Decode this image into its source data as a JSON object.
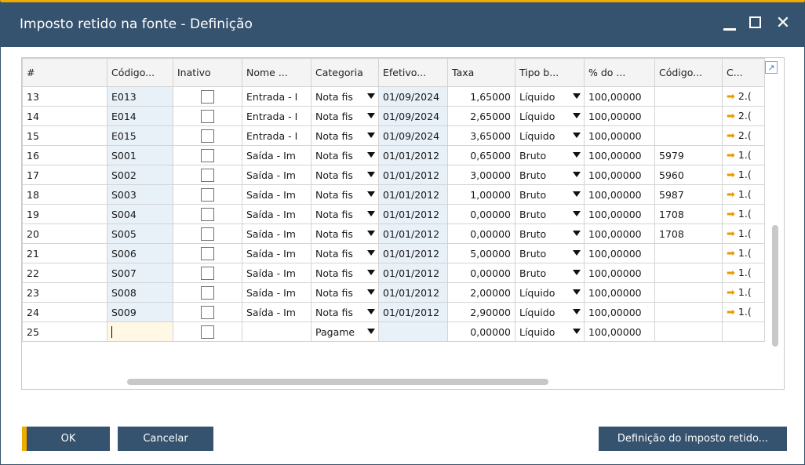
{
  "window": {
    "title": "Imposto retido na fonte - Definição",
    "accent_color": "#f0ab00",
    "titlebar_color": "#35526e"
  },
  "grid": {
    "columns": [
      "#",
      "Código...",
      "Inativo",
      "Nome ...",
      "Categoria",
      "Efetivo...",
      "Taxa",
      "Tipo b...",
      "% do ...",
      "Código...",
      "C..."
    ],
    "rows": [
      {
        "n": "13",
        "code": "E013",
        "name": "Entrada - I",
        "cat": "Nota fis",
        "eff": "01/09/2024",
        "rate": "1,65000",
        "base": "Líquido",
        "pct": "100,00000",
        "code2": "",
        "c": "2.("
      },
      {
        "n": "14",
        "code": "E014",
        "name": "Entrada - I",
        "cat": "Nota fis",
        "eff": "01/09/2024",
        "rate": "2,65000",
        "base": "Líquido",
        "pct": "100,00000",
        "code2": "",
        "c": "2.("
      },
      {
        "n": "15",
        "code": "E015",
        "name": "Entrada - I",
        "cat": "Nota fis",
        "eff": "01/09/2024",
        "rate": "3,65000",
        "base": "Líquido",
        "pct": "100,00000",
        "code2": "",
        "c": "2.("
      },
      {
        "n": "16",
        "code": "S001",
        "name": "Saída - Im",
        "cat": "Nota fis",
        "eff": "01/01/2012",
        "rate": "0,65000",
        "base": "Bruto",
        "pct": "100,00000",
        "code2": "5979",
        "c": "1.("
      },
      {
        "n": "17",
        "code": "S002",
        "name": "Saída - Im",
        "cat": "Nota fis",
        "eff": "01/01/2012",
        "rate": "3,00000",
        "base": "Bruto",
        "pct": "100,00000",
        "code2": "5960",
        "c": "1.("
      },
      {
        "n": "18",
        "code": "S003",
        "name": "Saída - Im",
        "cat": "Nota fis",
        "eff": "01/01/2012",
        "rate": "1,00000",
        "base": "Bruto",
        "pct": "100,00000",
        "code2": "5987",
        "c": "1.("
      },
      {
        "n": "19",
        "code": "S004",
        "name": "Saída - Im",
        "cat": "Nota fis",
        "eff": "01/01/2012",
        "rate": "0,00000",
        "base": "Bruto",
        "pct": "100,00000",
        "code2": "1708",
        "c": "1.("
      },
      {
        "n": "20",
        "code": "S005",
        "name": "Saída - Im",
        "cat": "Nota fis",
        "eff": "01/01/2012",
        "rate": "0,00000",
        "base": "Bruto",
        "pct": "100,00000",
        "code2": "1708",
        "c": "1.("
      },
      {
        "n": "21",
        "code": "S006",
        "name": "Saída - Im",
        "cat": "Nota fis",
        "eff": "01/01/2012",
        "rate": "5,00000",
        "base": "Bruto",
        "pct": "100,00000",
        "code2": "",
        "c": "1.("
      },
      {
        "n": "22",
        "code": "S007",
        "name": "Saída - Im",
        "cat": "Nota fis",
        "eff": "01/01/2012",
        "rate": "0,00000",
        "base": "Bruto",
        "pct": "100,00000",
        "code2": "",
        "c": "1.("
      },
      {
        "n": "23",
        "code": "S008",
        "name": "Saída - Im",
        "cat": "Nota fis",
        "eff": "01/01/2012",
        "rate": "2,00000",
        "base": "Líquido",
        "pct": "100,00000",
        "code2": "",
        "c": "1.("
      },
      {
        "n": "24",
        "code": "S009",
        "name": "Saída - Im",
        "cat": "Nota fis",
        "eff": "01/01/2012",
        "rate": "2,90000",
        "base": "Líquido",
        "pct": "100,00000",
        "code2": "",
        "c": "1.("
      }
    ],
    "new_row": {
      "n": "25",
      "cat": "Pagame",
      "rate": "0,00000",
      "base": "Líquido",
      "pct": "100,00000"
    }
  },
  "buttons": {
    "ok": "OK",
    "cancel": "Cancelar",
    "definition": "Definição do imposto retido..."
  }
}
